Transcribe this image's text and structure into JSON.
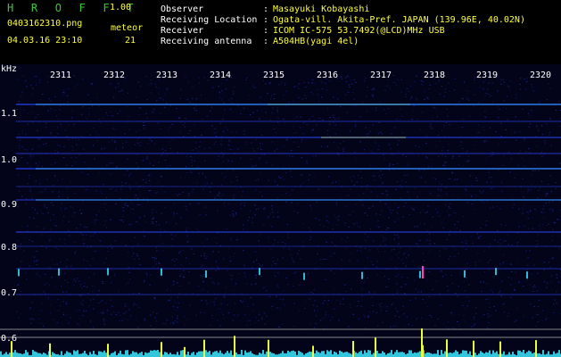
{
  "header": {
    "app_title": "H R O F F T",
    "version": "1.00",
    "file_name": "0403162310.png",
    "meteor_label": "meteor",
    "date_time": "04.03.16 23:10",
    "meteor_count": "21",
    "info_rows": [
      {
        "label": "Observer",
        "value": "Masayuki Kobayashi"
      },
      {
        "label": "Receiving Location",
        "value": "Ogata-vill. Akita-Pref. JAPAN (139.96E, 40.02N)"
      },
      {
        "label": "Receiver",
        "value": "ICOM IC-575 53.7492(@LCD)MHz USB"
      },
      {
        "label": "Receiving antenna",
        "value": "A504HB(yagi 4el)"
      }
    ]
  },
  "spectrogram": {
    "y_unit": "kHz",
    "y_ticks": [
      "1.1",
      "1.0",
      "0.9",
      "0.8",
      "0.7",
      "0.6"
    ],
    "time_ticks": [
      "2311",
      "2312",
      "2313",
      "2314",
      "2315",
      "2316",
      "2317",
      "2318",
      "2319",
      "2320"
    ],
    "colors": {
      "background": "#030319",
      "noise": "#1c2fa8",
      "signal": "#3ce8ff",
      "strong": "#e8ff3a"
    }
  }
}
